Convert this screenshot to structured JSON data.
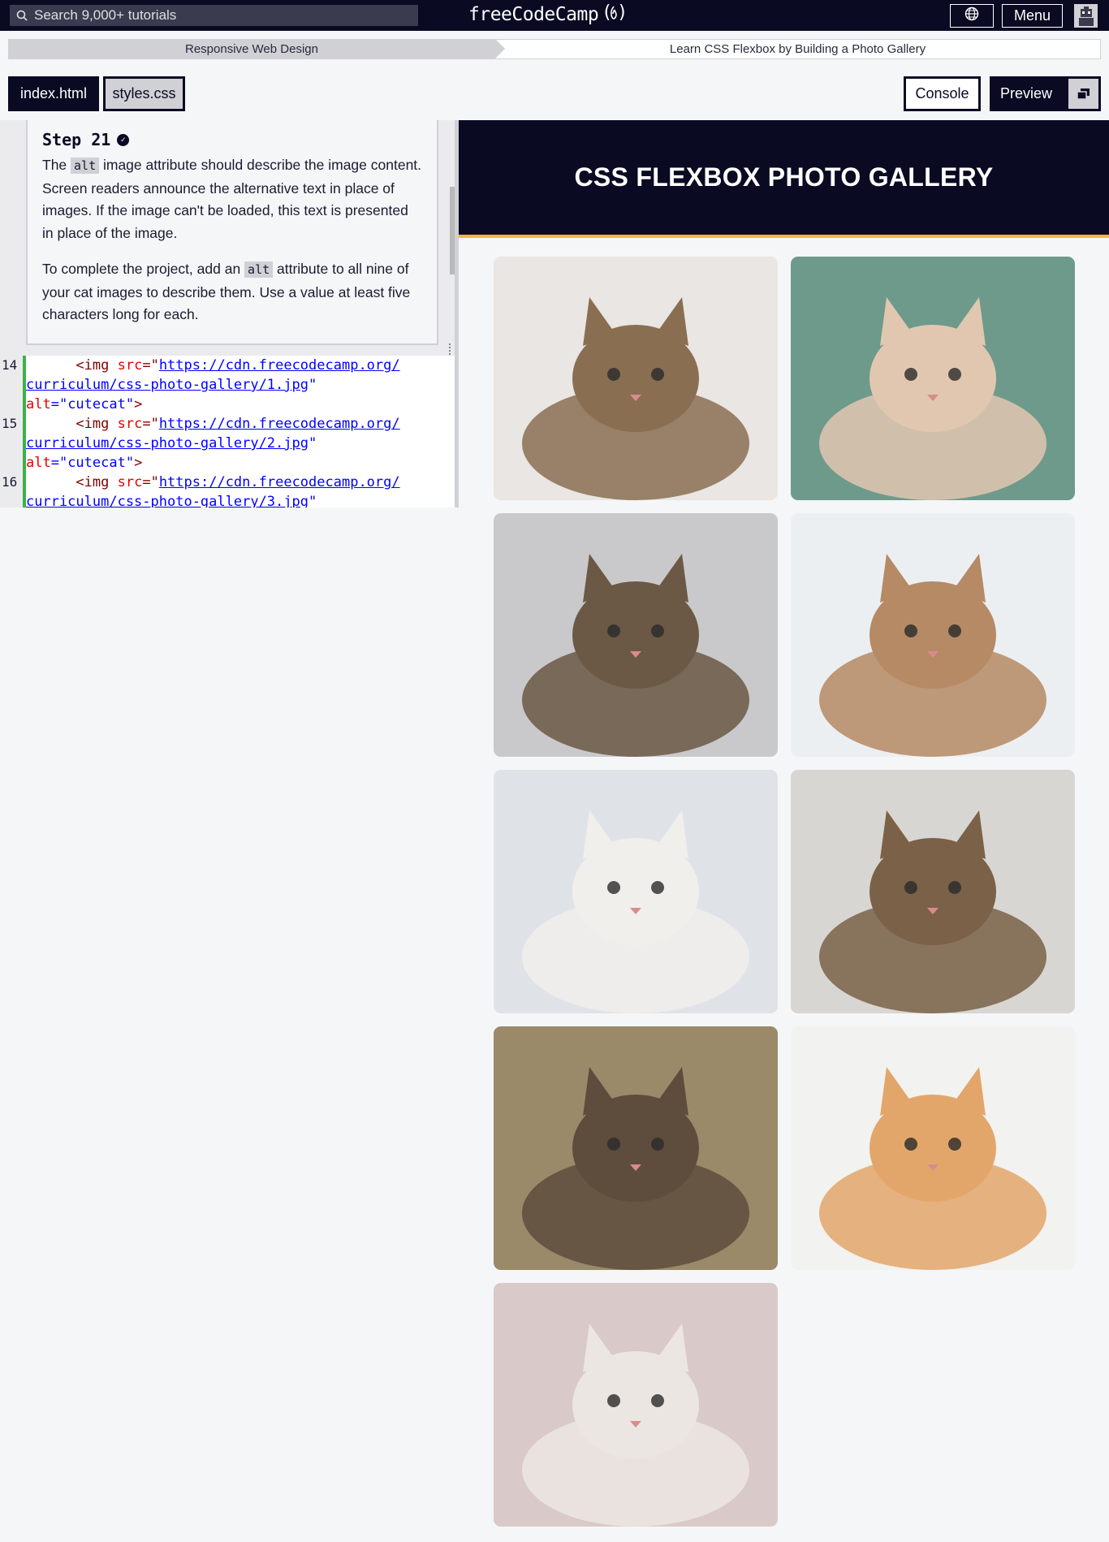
{
  "nav": {
    "search_placeholder": "Search 9,000+ tutorials",
    "logo_text": "freeCodeCamp",
    "menu_label": "Menu"
  },
  "breadcrumb": {
    "section": "Responsive Web Design",
    "project": "Learn CSS Flexbox by Building a Photo Gallery"
  },
  "tabs": {
    "index": "index.html",
    "styles": "styles.css",
    "console": "Console",
    "preview": "Preview"
  },
  "step": {
    "title": "Step 21",
    "p1_a": "The ",
    "p1_code": "alt",
    "p1_b": " image attribute should describe the image content. Screen readers announce the alternative text in place of images. If the image can't be loaded, this text is presented in place of the image.",
    "p2_a": "To complete the project, add an ",
    "p2_code": "alt",
    "p2_b": " attribute to all nine of your cat images to describe them. Use a value at least five characters long for each."
  },
  "code": {
    "lines": [
      {
        "num": "14",
        "indent": "      ",
        "tag_open": "<img ",
        "attr": "src",
        "eq": "=\"",
        "url1": "https://cdn.freecodecamp.org/",
        "url2": "curriculum/css-photo-gallery/1.jpg",
        "q": "\"",
        "alt_attr": "alt",
        "alt_val": "=\"cutecat\"",
        "close": ">"
      },
      {
        "num": "15",
        "indent": "      ",
        "tag_open": "<img ",
        "attr": "src",
        "eq": "=\"",
        "url1": "https://cdn.freecodecamp.org/",
        "url2": "curriculum/css-photo-gallery/2.jpg",
        "q": "\"",
        "alt_attr": "alt",
        "alt_val": "=\"cutecat\"",
        "close": ">"
      },
      {
        "num": "16",
        "indent": "      ",
        "tag_open": "<img ",
        "attr": "src",
        "eq": "=\"",
        "url1": "https://cdn.freecodecamp.org/",
        "url2": "curriculum/css-photo-gallery/3.jpg",
        "q": "\""
      }
    ]
  },
  "preview": {
    "heading": "CSS FLEXBOX PHOTO GALLERY",
    "images": [
      {
        "name": "sleeping-tabby-cat",
        "bg": "#e9e6e3",
        "fur": "#8a6e52"
      },
      {
        "name": "cat-lying-on-floor",
        "bg": "#6e9a8c",
        "fur": "#e2c7b0"
      },
      {
        "name": "long-haired-tabby-cat",
        "bg": "#c9c9cb",
        "fur": "#6b5845"
      },
      {
        "name": "cat-under-blanket",
        "bg": "#eceff2",
        "fur": "#b58a64"
      },
      {
        "name": "white-kitten",
        "bg": "#dfe3e8",
        "fur": "#f1efec"
      },
      {
        "name": "tabby-kittens",
        "bg": "#d8d6d2",
        "fur": "#7a6148"
      },
      {
        "name": "cat-under-rug",
        "bg": "#9a8a6a",
        "fur": "#5e4c3c"
      },
      {
        "name": "orange-kitten",
        "bg": "#f2f2f0",
        "fur": "#e3a66a"
      },
      {
        "name": "kittens-on-blanket",
        "bg": "#d9c9c8",
        "fur": "#ece6e2"
      }
    ]
  },
  "colors": {
    "nav_bg": "#0a0a23",
    "accent": "#fdb347",
    "gutter_green": "#3ab349"
  }
}
